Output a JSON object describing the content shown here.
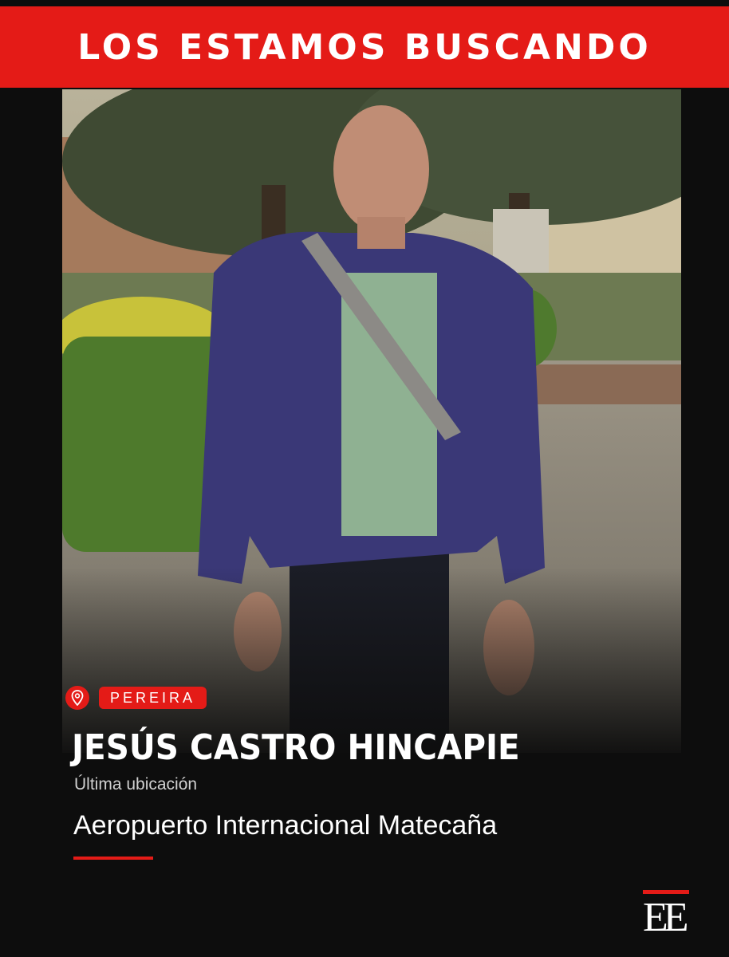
{
  "header": {
    "title": "LOS ESTAMOS BUSCANDO"
  },
  "location_badge": {
    "icon": "map-pin-icon",
    "city": "PEREIRA"
  },
  "person": {
    "name": "JESÚS CASTRO HINCAPIE",
    "last_seen_label": "Última ubicación",
    "last_seen_place": "Aeropuerto Internacional Matecaña"
  },
  "brand": {
    "logo_text": "EE"
  },
  "colors": {
    "accent": "#e41b17",
    "background": "#0d0d0d",
    "text": "#ffffff"
  }
}
